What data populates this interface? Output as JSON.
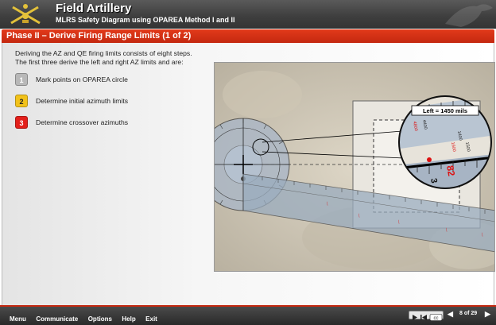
{
  "header": {
    "title": "Field Artillery",
    "subtitle": "MLRS Safety Diagram using OPAREA Method I and II"
  },
  "phase": {
    "title": "Phase II – Derive Firing Range Limits (1 of 2)"
  },
  "intro": {
    "line1": "Deriving the AZ and QE firing limits consists of eight steps.",
    "line2": "The first three derive the left and right AZ limits and are:"
  },
  "steps": [
    {
      "number": "1",
      "label": "Mark points on OPAREA circle",
      "color": "#b8b8b8"
    },
    {
      "number": "2",
      "label": "Determine initial azimuth limits",
      "color": "#f2c21a"
    },
    {
      "number": "3",
      "label": "Determine crossover azimuths",
      "color": "#e3201b"
    }
  ],
  "diagram": {
    "callout": "Left = 1450 mils",
    "mag_numbers": [
      "1400",
      "1500",
      "1600",
      "4800",
      "4400",
      "3",
      "82"
    ]
  },
  "footer": {
    "menu": [
      "Menu",
      "Communicate",
      "Options",
      "Help",
      "Exit"
    ],
    "page": "8 of 29",
    "cc_label": "cc"
  },
  "colors": {
    "accent": "#c42810",
    "header": "#3e3e3e"
  }
}
